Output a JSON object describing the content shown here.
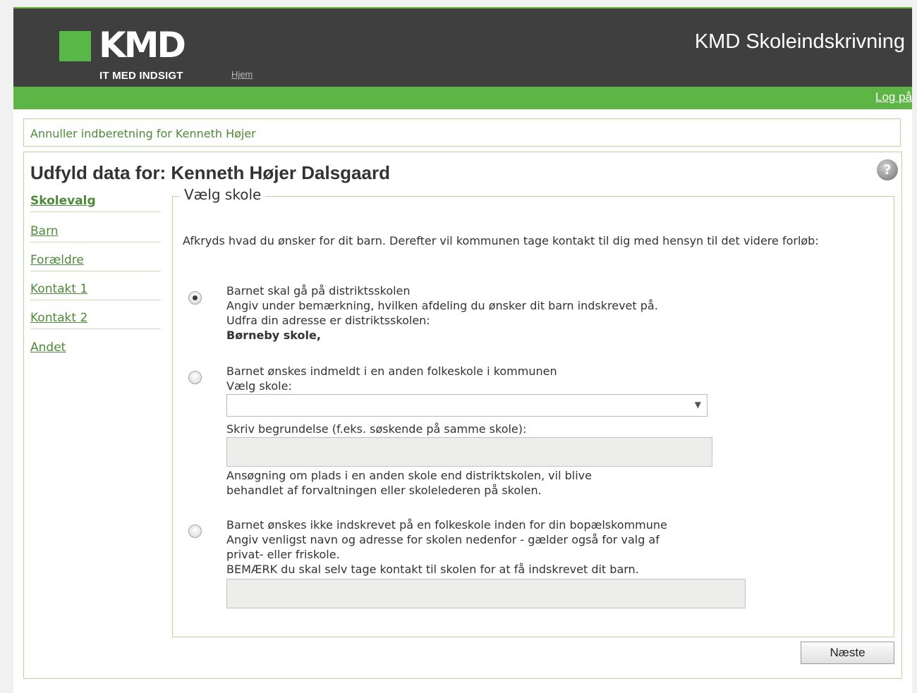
{
  "header": {
    "logo_text": "KMD",
    "logo_tagline": "IT MED INDSIGT",
    "nav_home": "Hjem",
    "app_title": "KMD Skoleindskrivning",
    "login_link": "Log på"
  },
  "cancel_link": "Annuller indberetning for Kenneth Højer",
  "page_title": "Udfyld data for: Kenneth Højer Dalsgaard",
  "sidebar": {
    "items": [
      {
        "label": "Skolevalg",
        "active": true
      },
      {
        "label": "Barn"
      },
      {
        "label": "Forældre"
      },
      {
        "label": "Kontakt 1"
      },
      {
        "label": "Kontakt 2"
      },
      {
        "label": "Andet"
      }
    ]
  },
  "section": {
    "legend": "Vælg skole",
    "instruction": "Afkryds hvad du ønsker for dit barn. Derefter vil kommunen tage kontakt til dig med hensyn til det videre forløb:",
    "option1": {
      "checked": true,
      "lines": [
        "Barnet skal gå på distriktsskolen",
        "Angiv under bemærkning, hvilken afdeling du ønsker dit barn indskrevet på.",
        "Udfra din adresse er distriktsskolen:"
      ],
      "school": "Børneby skole,"
    },
    "option2": {
      "checked": false,
      "title": "Barnet ønskes indmeldt i en anden folkeskole i kommunen",
      "select_label": "Vælg skole:",
      "select_value": "",
      "reason_label": "Skriv begrundelse (f.eks. søskende på samme skole):",
      "reason_value": "",
      "note_lines": [
        "Ansøgning om plads i en anden skole end distriktskolen, vil blive",
        "behandlet af forvaltningen eller skolelederen på skolen."
      ]
    },
    "option3": {
      "checked": false,
      "lines": [
        "Barnet ønskes ikke indskrevet på en folkeskole inden for din bopælskommune",
        "Angiv venligst navn og adresse for skolen nedenfor - gælder også for valg af",
        "privat- eller friskole.",
        "BEMÆRK du skal selv tage kontakt til skolen for at få indskrevet dit barn."
      ],
      "value": ""
    }
  },
  "next_button": "Næste",
  "colors": {
    "header_bg": "#3f3f3f",
    "brand_green": "#5cb545",
    "link_green": "#4d8a3a",
    "border_green": "#b6d79e"
  }
}
